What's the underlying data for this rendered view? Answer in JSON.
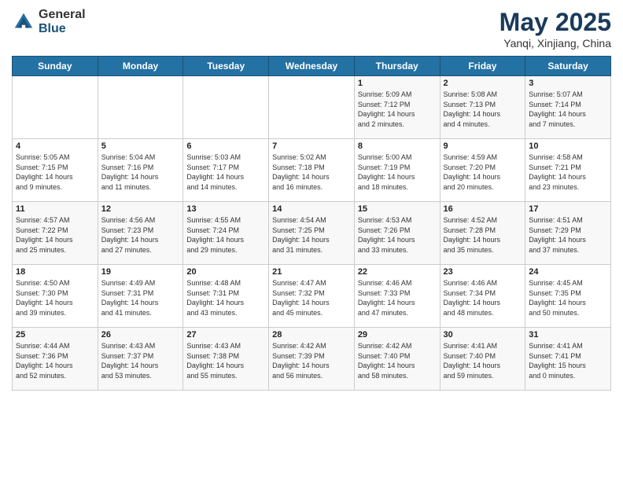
{
  "logo": {
    "general": "General",
    "blue": "Blue"
  },
  "title": "May 2025",
  "subtitle": "Yanqi, Xinjiang, China",
  "header": {
    "days": [
      "Sunday",
      "Monday",
      "Tuesday",
      "Wednesday",
      "Thursday",
      "Friday",
      "Saturday"
    ]
  },
  "weeks": [
    [
      {
        "day": "",
        "detail": ""
      },
      {
        "day": "",
        "detail": ""
      },
      {
        "day": "",
        "detail": ""
      },
      {
        "day": "",
        "detail": ""
      },
      {
        "day": "1",
        "detail": "Sunrise: 5:09 AM\nSunset: 7:12 PM\nDaylight: 14 hours\nand 2 minutes."
      },
      {
        "day": "2",
        "detail": "Sunrise: 5:08 AM\nSunset: 7:13 PM\nDaylight: 14 hours\nand 4 minutes."
      },
      {
        "day": "3",
        "detail": "Sunrise: 5:07 AM\nSunset: 7:14 PM\nDaylight: 14 hours\nand 7 minutes."
      }
    ],
    [
      {
        "day": "4",
        "detail": "Sunrise: 5:05 AM\nSunset: 7:15 PM\nDaylight: 14 hours\nand 9 minutes."
      },
      {
        "day": "5",
        "detail": "Sunrise: 5:04 AM\nSunset: 7:16 PM\nDaylight: 14 hours\nand 11 minutes."
      },
      {
        "day": "6",
        "detail": "Sunrise: 5:03 AM\nSunset: 7:17 PM\nDaylight: 14 hours\nand 14 minutes."
      },
      {
        "day": "7",
        "detail": "Sunrise: 5:02 AM\nSunset: 7:18 PM\nDaylight: 14 hours\nand 16 minutes."
      },
      {
        "day": "8",
        "detail": "Sunrise: 5:00 AM\nSunset: 7:19 PM\nDaylight: 14 hours\nand 18 minutes."
      },
      {
        "day": "9",
        "detail": "Sunrise: 4:59 AM\nSunset: 7:20 PM\nDaylight: 14 hours\nand 20 minutes."
      },
      {
        "day": "10",
        "detail": "Sunrise: 4:58 AM\nSunset: 7:21 PM\nDaylight: 14 hours\nand 23 minutes."
      }
    ],
    [
      {
        "day": "11",
        "detail": "Sunrise: 4:57 AM\nSunset: 7:22 PM\nDaylight: 14 hours\nand 25 minutes."
      },
      {
        "day": "12",
        "detail": "Sunrise: 4:56 AM\nSunset: 7:23 PM\nDaylight: 14 hours\nand 27 minutes."
      },
      {
        "day": "13",
        "detail": "Sunrise: 4:55 AM\nSunset: 7:24 PM\nDaylight: 14 hours\nand 29 minutes."
      },
      {
        "day": "14",
        "detail": "Sunrise: 4:54 AM\nSunset: 7:25 PM\nDaylight: 14 hours\nand 31 minutes."
      },
      {
        "day": "15",
        "detail": "Sunrise: 4:53 AM\nSunset: 7:26 PM\nDaylight: 14 hours\nand 33 minutes."
      },
      {
        "day": "16",
        "detail": "Sunrise: 4:52 AM\nSunset: 7:28 PM\nDaylight: 14 hours\nand 35 minutes."
      },
      {
        "day": "17",
        "detail": "Sunrise: 4:51 AM\nSunset: 7:29 PM\nDaylight: 14 hours\nand 37 minutes."
      }
    ],
    [
      {
        "day": "18",
        "detail": "Sunrise: 4:50 AM\nSunset: 7:30 PM\nDaylight: 14 hours\nand 39 minutes."
      },
      {
        "day": "19",
        "detail": "Sunrise: 4:49 AM\nSunset: 7:31 PM\nDaylight: 14 hours\nand 41 minutes."
      },
      {
        "day": "20",
        "detail": "Sunrise: 4:48 AM\nSunset: 7:31 PM\nDaylight: 14 hours\nand 43 minutes."
      },
      {
        "day": "21",
        "detail": "Sunrise: 4:47 AM\nSunset: 7:32 PM\nDaylight: 14 hours\nand 45 minutes."
      },
      {
        "day": "22",
        "detail": "Sunrise: 4:46 AM\nSunset: 7:33 PM\nDaylight: 14 hours\nand 47 minutes."
      },
      {
        "day": "23",
        "detail": "Sunrise: 4:46 AM\nSunset: 7:34 PM\nDaylight: 14 hours\nand 48 minutes."
      },
      {
        "day": "24",
        "detail": "Sunrise: 4:45 AM\nSunset: 7:35 PM\nDaylight: 14 hours\nand 50 minutes."
      }
    ],
    [
      {
        "day": "25",
        "detail": "Sunrise: 4:44 AM\nSunset: 7:36 PM\nDaylight: 14 hours\nand 52 minutes."
      },
      {
        "day": "26",
        "detail": "Sunrise: 4:43 AM\nSunset: 7:37 PM\nDaylight: 14 hours\nand 53 minutes."
      },
      {
        "day": "27",
        "detail": "Sunrise: 4:43 AM\nSunset: 7:38 PM\nDaylight: 14 hours\nand 55 minutes."
      },
      {
        "day": "28",
        "detail": "Sunrise: 4:42 AM\nSunset: 7:39 PM\nDaylight: 14 hours\nand 56 minutes."
      },
      {
        "day": "29",
        "detail": "Sunrise: 4:42 AM\nSunset: 7:40 PM\nDaylight: 14 hours\nand 58 minutes."
      },
      {
        "day": "30",
        "detail": "Sunrise: 4:41 AM\nSunset: 7:40 PM\nDaylight: 14 hours\nand 59 minutes."
      },
      {
        "day": "31",
        "detail": "Sunrise: 4:41 AM\nSunset: 7:41 PM\nDaylight: 15 hours\nand 0 minutes."
      }
    ]
  ]
}
